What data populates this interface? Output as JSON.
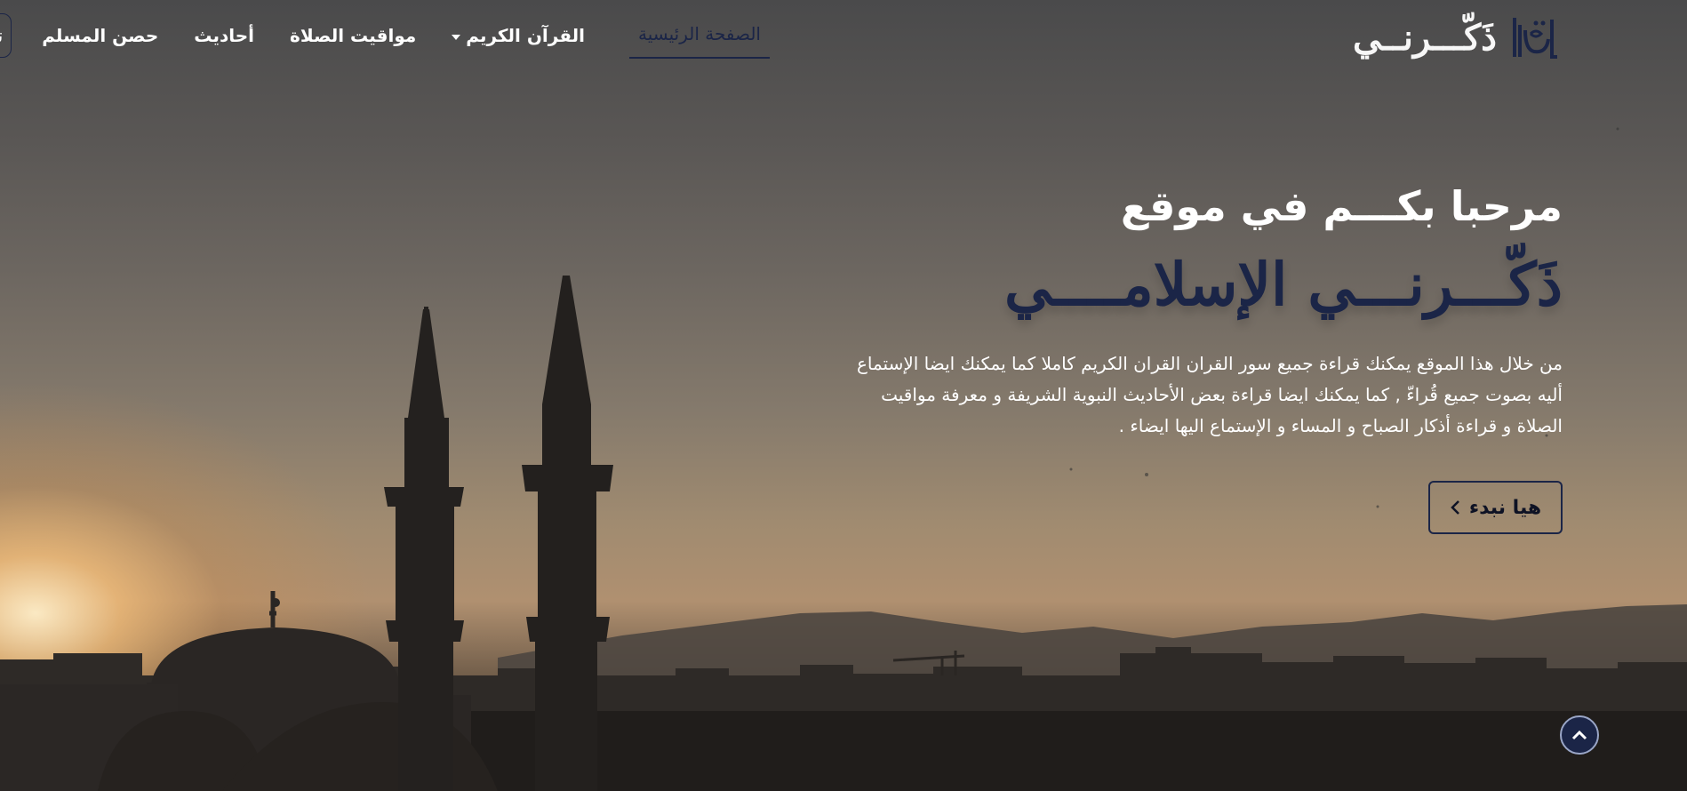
{
  "brand": {
    "logo_text": "ذَكّـــرنــي",
    "logo_icon": "calligraphy-logo-icon"
  },
  "nav": {
    "home": "الصفحة الرئيسية",
    "quran": "القرآن الكريم",
    "prayer_times": "مواقيت الصلاة",
    "hadith": "أحاديث",
    "hisn": "حصن المسلم",
    "contact": "تواصل معنا"
  },
  "hero": {
    "welcome": "مرحبا بكـــم في موقع",
    "site_name": "ذَكّـــرنـــي الإسلامــــي",
    "description": "من خلال هذا الموقع يمكنك قراءة جميع سور القران القران الكريم كاملا كما يمكنك ايضا الإستماع أليه بصوت جميع قُراءّ , كما يمكنك ايضا قراءة بعض الأحاديث النبوية الشريفة و معرفة مواقيت الصلاة و قراءة أذكار الصباح و المساء و الإستماع اليها ايضاء .",
    "cta": "هيا نبدء",
    "cta_icon": "chevron-left-icon"
  },
  "scroll_top_icon": "chevron-up-icon",
  "colors": {
    "accent": "#1b2547",
    "text": "#ffffff"
  }
}
